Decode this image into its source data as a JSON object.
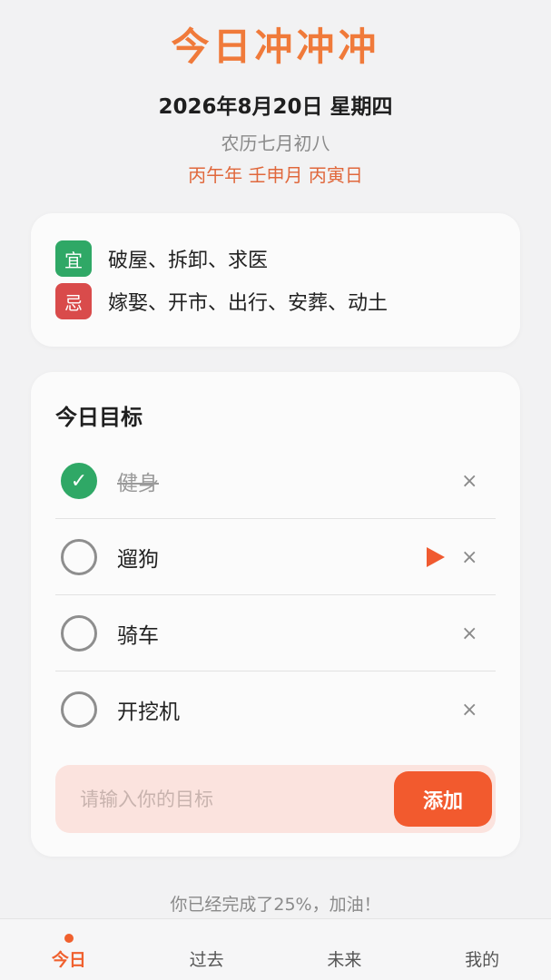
{
  "header": {
    "title": "今日冲冲冲",
    "date": "2026年8月20日 星期四",
    "lunar": "农历七月初八",
    "ganzhi": "丙午年 壬申月 丙寅日"
  },
  "almanac": {
    "good_label": "宜",
    "good_items": "破屋、拆卸、求医",
    "bad_label": "忌",
    "bad_items": "嫁娶、开市、出行、安葬、动土",
    "colors": {
      "good": "#2fa866",
      "bad": "#d94b4b"
    }
  },
  "goals": {
    "title": "今日目标",
    "items": [
      {
        "text": "健身",
        "done": true
      },
      {
        "text": "遛狗",
        "done": false,
        "active": true
      },
      {
        "text": "骑车",
        "done": false
      },
      {
        "text": "开挖机",
        "done": false
      }
    ],
    "delete_glyph": "×",
    "check_glyph": "✓",
    "input_placeholder": "请输入你的目标",
    "add_label": "添加"
  },
  "progress": {
    "text": "你已经完成了25%，加油！",
    "percent": 25
  },
  "nav": {
    "tabs": [
      {
        "label": "今日",
        "active": true
      },
      {
        "label": "过去",
        "active": false
      },
      {
        "label": "未来",
        "active": false
      },
      {
        "label": "我的",
        "active": false
      }
    ]
  },
  "colors": {
    "accent": "#f25a2e",
    "title": "#f07a3a"
  }
}
